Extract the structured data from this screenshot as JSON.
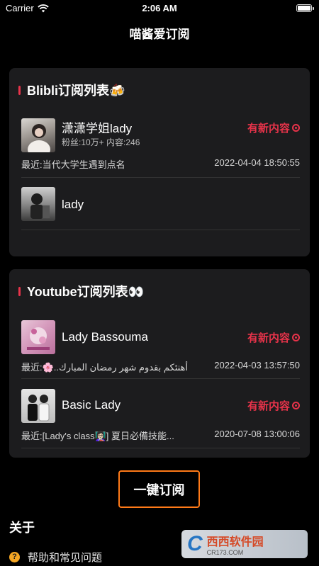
{
  "status_bar": {
    "carrier": "Carrier",
    "time": "2:06 AM",
    "battery_level": 1.0
  },
  "nav": {
    "title": "喵酱爱订阅"
  },
  "blibli": {
    "title": "Blibli订阅列表🍻",
    "items": [
      {
        "name": "潇潇学姐lady",
        "stats": "粉丝:10万+ 内容:246",
        "badge": "有新内容",
        "latest": "最近:当代大学生遇到点名",
        "time": "2022-04-04 18:50:55"
      },
      {
        "name": "lady"
      }
    ]
  },
  "youtube": {
    "title": "Youtube订阅列表👀",
    "items": [
      {
        "name": "Lady Bassouma",
        "badge": "有新内容",
        "latest": "最近:🌸..أهنئكم بقدوم شهر رمضان المبارك",
        "time": "2022-04-03 13:57:50"
      },
      {
        "name": "Basic Lady",
        "badge": "有新内容",
        "latest": "最近:[Lady's class👩🏻‍🏫] 夏日必備技能...",
        "time": "2020-07-08 13:00:06"
      }
    ]
  },
  "subscribe_button": "一键订阅",
  "about": {
    "title": "关于",
    "help": "帮助和常见问题",
    "help_icon": "question-icon"
  },
  "watermark": {
    "brand": "西西软件园",
    "site": "CR173.COM"
  },
  "colors": {
    "accent": "#e8334a",
    "button_border": "#ff7a18",
    "card": "#1c1c1e"
  }
}
